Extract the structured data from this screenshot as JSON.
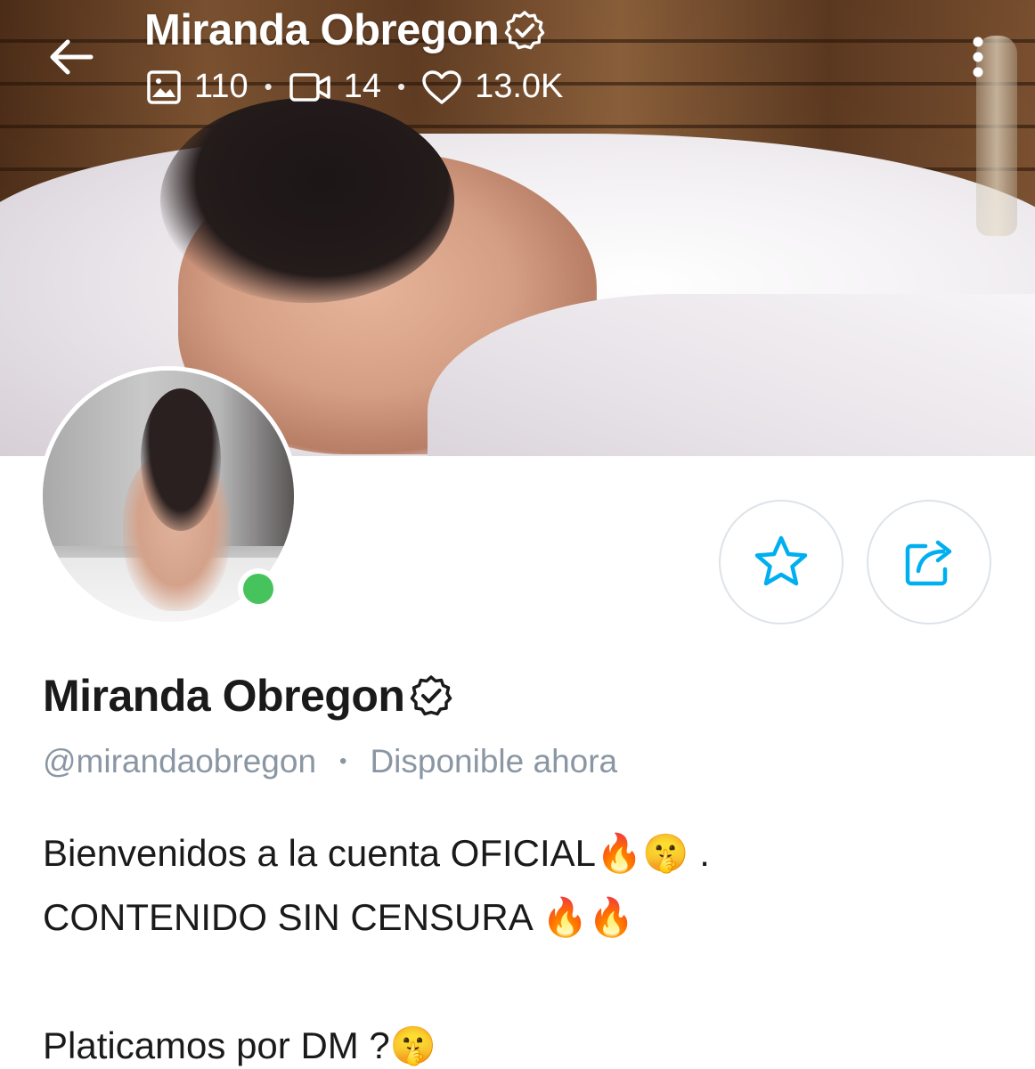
{
  "header": {
    "title": "Miranda Obregon",
    "stats": {
      "photos": "110",
      "videos": "14",
      "likes": "13.0K"
    },
    "separator": "•"
  },
  "profile": {
    "name": "Miranda Obregon",
    "username": "@mirandaobregon",
    "separator": "•",
    "status": "Disponible ahora",
    "online": true
  },
  "bio": {
    "line1": "Bienvenidos a la cuenta OFICIAL🔥🤫 .",
    "line2": "CONTENIDO SIN CENSURA 🔥🔥",
    "line3": "Platicamos por DM ?🤫"
  },
  "colors": {
    "accent": "#00aff0",
    "online": "#47c35d",
    "muted_text": "#8a96a3",
    "button_border": "#dde3e9"
  },
  "icons": {
    "back": "arrow-left-icon",
    "verified": "verified-badge-icon",
    "photos": "image-icon",
    "videos": "video-camera-icon",
    "likes": "heart-icon",
    "more": "more-vertical-icon",
    "favorite": "star-icon",
    "share": "share-icon"
  }
}
